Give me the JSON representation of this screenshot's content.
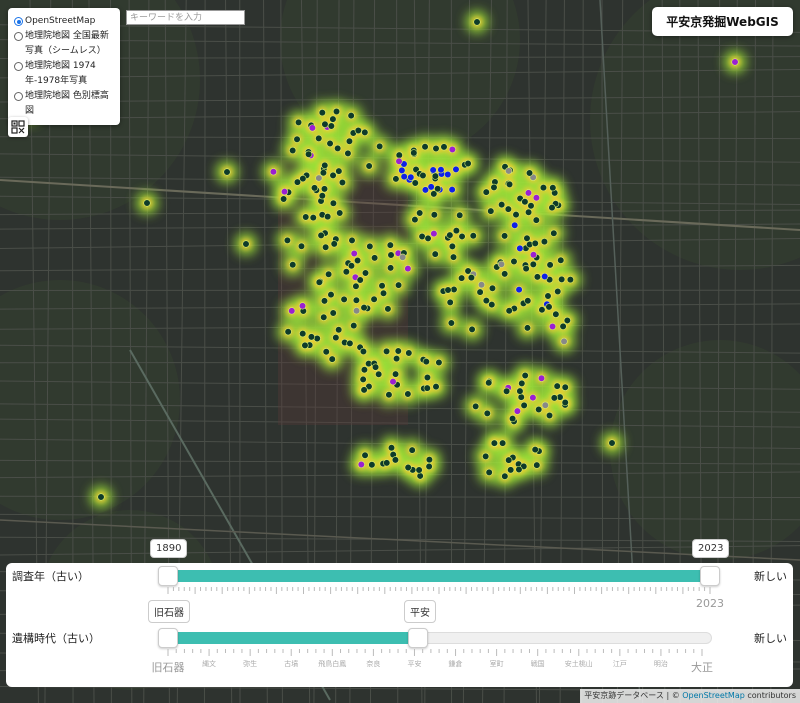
{
  "title": "平安京発掘WebGIS",
  "search": {
    "placeholder": "キーワードを入力"
  },
  "layers": [
    {
      "label": "OpenStreetMap",
      "selected": true
    },
    {
      "label": "地理院地図 全国最新写真（シームレス）",
      "selected": false
    },
    {
      "label": "地理院地図 1974年-1978年写真",
      "selected": false
    },
    {
      "label": "地理院地図 色別標高図",
      "selected": false
    }
  ],
  "qr_button": {
    "icon": "qr-code-icon"
  },
  "slider_year": {
    "label": "調査年（古い）",
    "right_label": "新しい",
    "min_value": "1890",
    "max_value": "2023",
    "end_tick": "2023"
  },
  "slider_era": {
    "label": "遺構時代（古い）",
    "right_label": "新しい",
    "min_value": "旧石器",
    "max_value": "平安",
    "ticks": [
      "旧石器",
      "縄文",
      "弥生",
      "古墳",
      "飛鳥白鳳",
      "奈良",
      "平安",
      "鎌倉",
      "室町",
      "戦国",
      "安土桃山",
      "江戸",
      "明治",
      "大正"
    ]
  },
  "attribution": {
    "source": "平安京跡データベース",
    "separator": " | © ",
    "osm": "OpenStreetMap",
    "contributors": " contributors"
  },
  "colors": {
    "point_default": "#0f3b2a",
    "point_purple": "#9b1fd1",
    "point_blue": "#1020e8",
    "point_gray": "#888888",
    "heat_inner": "#f2c933",
    "heat_outer": "#9ee33a",
    "slider_fill": "#3dbeb1"
  }
}
